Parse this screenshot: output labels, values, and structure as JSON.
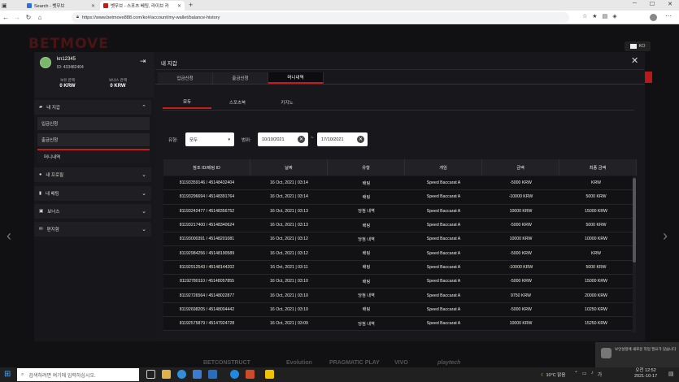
{
  "browser": {
    "tabs": [
      {
        "title": "Search - 벳무브"
      },
      {
        "title": "벳무브 - 스포츠 베팅, 라이브 카"
      }
    ],
    "new_tab": "+",
    "url": "https://www.betmove888.com/ko#/account/my-wallet/balance-history"
  },
  "site": {
    "logo": "BETMOVE",
    "lang": "KO"
  },
  "user": {
    "name": "kn12345",
    "id": "ID: 433482404",
    "balance_label": "보유 잔액",
    "balance_value": "0 KRW",
    "bonus_label": "보너스 잔액",
    "bonus_value": "0 KRW"
  },
  "sidebar": {
    "wallet": "내 지갑",
    "deposit": "입금신청",
    "withdraw": "출금신청",
    "history": "머니내역",
    "profile": "내 프로필",
    "bets": "내 배팅",
    "bonus": "보너스",
    "inbox": "편지함"
  },
  "modal": {
    "title": "내 지갑",
    "tabs": [
      "입금신청",
      "출금신청",
      "머니내역"
    ],
    "subtabs": [
      "모두",
      "스포츠북",
      "카지노"
    ],
    "filter_type_label": "유형:",
    "filter_type_value": "모두",
    "filter_range_label": "범위:",
    "date_from": "10/10/2021",
    "date_sep": "~",
    "date_to": "17/10/2021"
  },
  "table": {
    "headers": [
      "참조 ID/베팅 ID",
      "날짜",
      "유형",
      "게임",
      "금액",
      "최종 금액"
    ],
    "rows": [
      [
        "81193359146 / 45148432404",
        "16 Oct, 2021 | 03:14",
        "배팅",
        "Speed Baccarat A",
        "-5000 KRW",
        "KRW"
      ],
      [
        "81193296694 / 45148391764",
        "16 Oct, 2021 | 03:14",
        "배팅",
        "Speed Baccarat A",
        "-10000 KRW",
        "5000 KRW"
      ],
      [
        "81193242477 / 45148356752",
        "16 Oct, 2021 | 03:13",
        "당첨 내역",
        "Speed Baccarat A",
        "10000 KRW",
        "15000 KRW"
      ],
      [
        "81193217400 / 45148340624",
        "16 Oct, 2021 | 03:13",
        "배팅",
        "Speed Baccarat A",
        "-5000 KRW",
        "5000 KRW"
      ],
      [
        "81193000391 / 45148201081",
        "16 Oct, 2021 | 03:12",
        "당첨 내역",
        "Speed Baccarat A",
        "10000 KRW",
        "10000 KRW"
      ],
      [
        "81192984256 / 45148190589",
        "16 Oct, 2021 | 03:12",
        "배팅",
        "Speed Baccarat A",
        "-5000 KRW",
        "KRW"
      ],
      [
        "81192912543 / 45148144202",
        "16 Oct, 2021 | 03:11",
        "배팅",
        "Speed Baccarat A",
        "-10000 KRW",
        "5000 KRW"
      ],
      [
        "81192780110 / 45148057855",
        "16 Oct, 2021 | 03:10",
        "배팅",
        "Speed Baccarat A",
        "-5000 KRW",
        "15000 KRW"
      ],
      [
        "81192726564 / 45148022877",
        "16 Oct, 2021 | 03:10",
        "당첨 내역",
        "Speed Baccarat A",
        "9750 KRW",
        "20000 KRW"
      ],
      [
        "81192698205 / 45148004442",
        "16 Oct, 2021 | 03:10",
        "배팅",
        "Speed Baccarat A",
        "-5000 KRW",
        "10250 KRW"
      ],
      [
        "81192575879 / 45147924728",
        "16 Oct, 2021 | 03:09",
        "당첨 내역",
        "Speed Baccarat A",
        "10000 KRW",
        "15250 KRW"
      ]
    ]
  },
  "footer_logos": [
    "BETCONSTRUCT",
    "Evolution",
    "PRAGMATIC PLAY",
    "VIVO",
    "playtech"
  ],
  "notification": "보안설정에 새로운 작업 필요가 있습니다",
  "taskbar": {
    "search_placeholder": "검색하려면 여기에 입력하십시오.",
    "weather": "10°C 맑음",
    "time": "오전 12:52",
    "date": "2021-10-17"
  }
}
